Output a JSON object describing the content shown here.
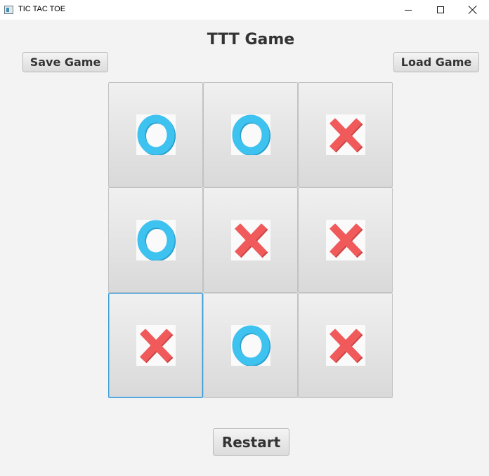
{
  "window": {
    "title": "TIC TAC TOE"
  },
  "header": {
    "title": "TTT Game"
  },
  "buttons": {
    "save": "Save Game",
    "load": "Load Game",
    "restart": "Restart"
  },
  "colors": {
    "x_mark": "#f05a5a",
    "o_mark": "#3ec2f0",
    "focus": "#3a9bd5"
  },
  "board": {
    "cells": [
      "O",
      "O",
      "X",
      "O",
      "X",
      "X",
      "X",
      "O",
      "X"
    ],
    "focused_index": 6
  }
}
